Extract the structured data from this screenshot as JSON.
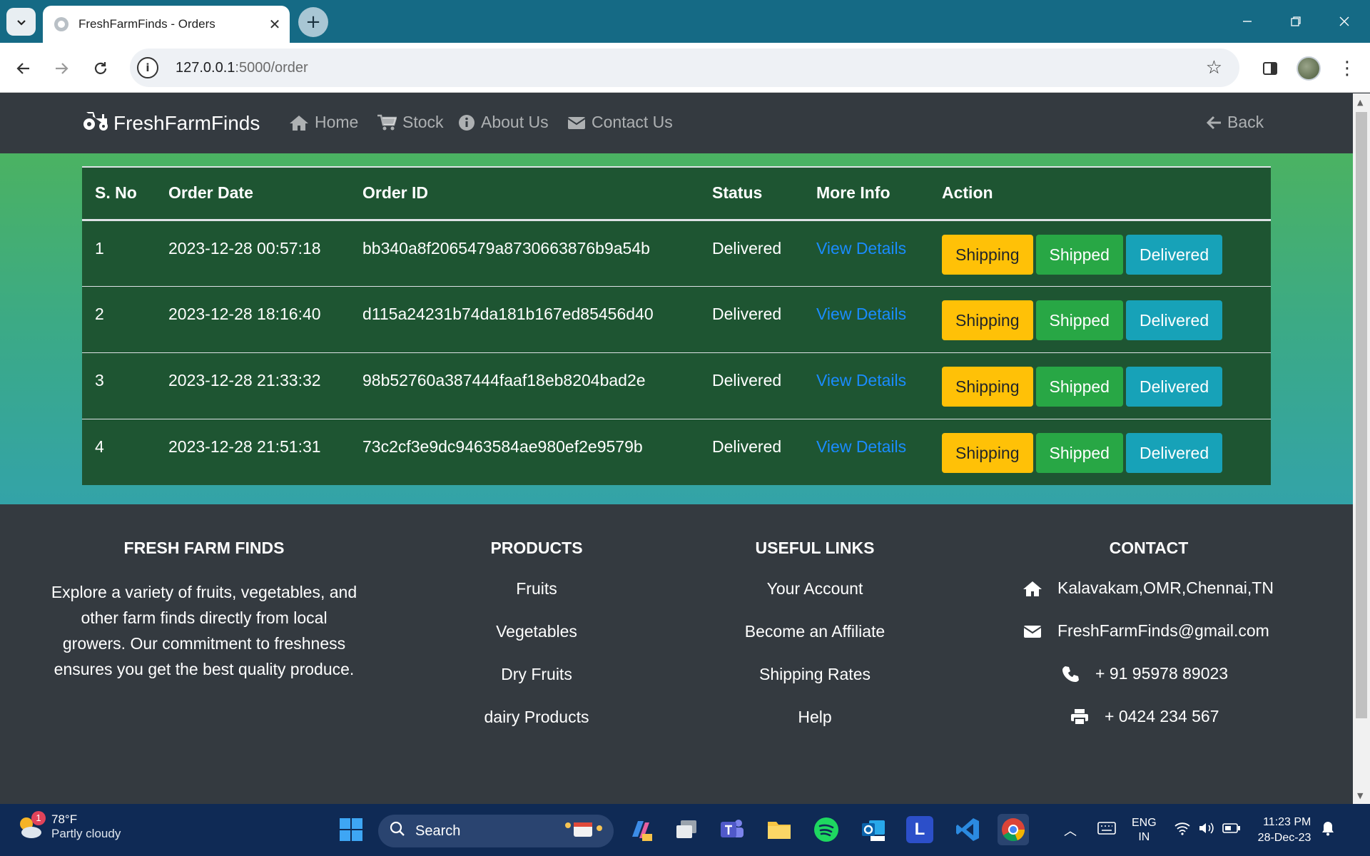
{
  "browser": {
    "tab_title": "FreshFarmFinds - Orders",
    "url_host": "127.0.0.1",
    "url_rest": ":5000/order",
    "new_tab_symbol": "+",
    "close_symbol": "✕"
  },
  "navbar": {
    "brand": "FreshFarmFinds",
    "links": [
      {
        "label": "Home",
        "icon": "home-icon"
      },
      {
        "label": "Stock",
        "icon": "cart-icon"
      },
      {
        "label": "About Us",
        "icon": "info-icon"
      },
      {
        "label": "Contact Us",
        "icon": "envelope-icon"
      }
    ],
    "back_label": "Back"
  },
  "orders": {
    "headers": [
      "S. No",
      "Order Date",
      "Order ID",
      "Status",
      "More Info",
      "Action"
    ],
    "rows": [
      {
        "sno": "1",
        "date": "2023-12-28 00:57:18",
        "id": "bb340a8f2065479a8730663876b9a54b",
        "status": "Delivered",
        "more": "View Details"
      },
      {
        "sno": "2",
        "date": "2023-12-28 18:16:40",
        "id": "d115a24231b74da181b167ed85456d40",
        "status": "Delivered",
        "more": "View Details"
      },
      {
        "sno": "3",
        "date": "2023-12-28 21:33:32",
        "id": "98b52760a387444faaf18eb8204bad2e",
        "status": "Delivered",
        "more": "View Details"
      },
      {
        "sno": "4",
        "date": "2023-12-28 21:51:31",
        "id": "73c2cf3e9dc9463584ae980ef2e9579b",
        "status": "Delivered",
        "more": "View Details"
      }
    ],
    "actions": {
      "shipping": "Shipping",
      "shipped": "Shipped",
      "delivered": "Delivered"
    },
    "colors": {
      "shipping": "#ffc107",
      "shipped": "#28a745",
      "delivered": "#17a2b8",
      "link": "#1a8cff"
    }
  },
  "footer": {
    "about_title": "FRESH FARM FINDS",
    "about_text": "Explore a variety of fruits, vegetables, and other farm finds directly from local growers. Our commitment to freshness ensures you get the best quality produce.",
    "products_title": "PRODUCTS",
    "products": [
      "Fruits",
      "Vegetables",
      "Dry Fruits",
      "dairy Products"
    ],
    "links_title": "USEFUL LINKS",
    "links": [
      "Your Account",
      "Become an Affiliate",
      "Shipping Rates",
      "Help"
    ],
    "contact_title": "CONTACT",
    "contact": {
      "address": "Kalavakam,OMR,Chennai,TN",
      "email": "FreshFarmFinds@gmail.com",
      "phone": "+ 91 95978 89023",
      "fax": "+ 0424 234 567"
    }
  },
  "taskbar": {
    "weather_temp": "78°F",
    "weather_desc": "Partly cloudy",
    "weather_badge": "1",
    "search_label": "Search",
    "lang": "ENG",
    "region": "IN",
    "time": "11:23 PM",
    "date": "28-Dec-23"
  }
}
